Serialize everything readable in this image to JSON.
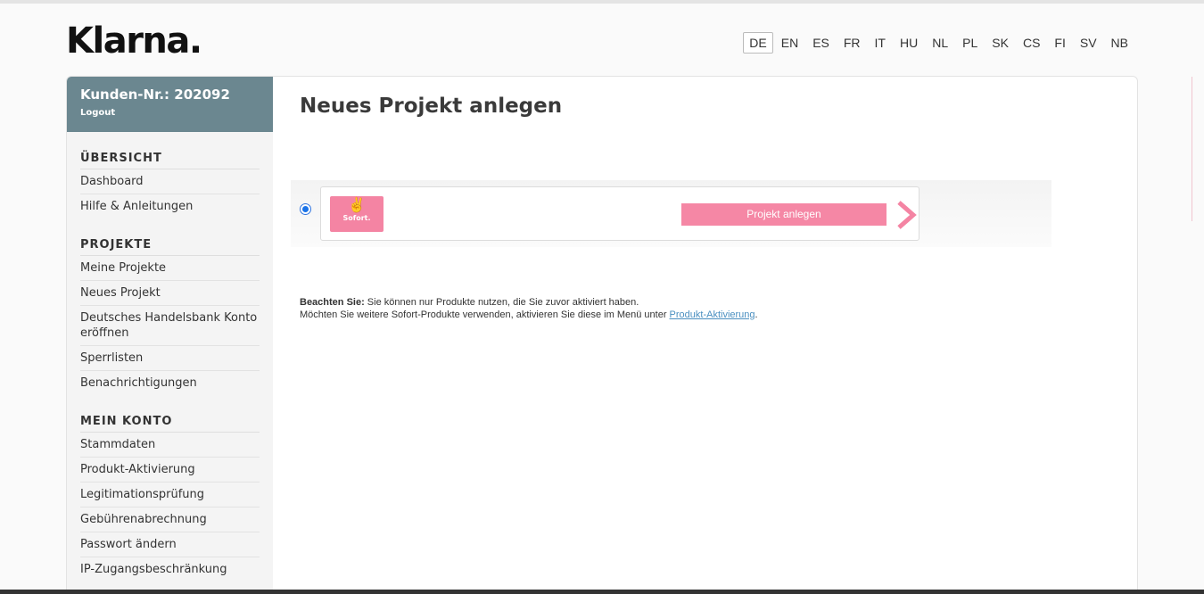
{
  "brand": {
    "logo_text": "Klarna."
  },
  "languages": {
    "active": "DE",
    "items": [
      "DE",
      "EN",
      "ES",
      "FR",
      "IT",
      "HU",
      "NL",
      "PL",
      "SK",
      "CS",
      "FI",
      "SV",
      "NB"
    ]
  },
  "account": {
    "customer_number": "Kunden-Nr.: 202092",
    "logout": "Logout"
  },
  "sidebar": {
    "sections": [
      {
        "title": "ÜBERSICHT",
        "items": [
          "Dashboard",
          "Hilfe & Anleitungen"
        ]
      },
      {
        "title": "PROJEKTE",
        "items": [
          "Meine Projekte",
          "Neues Projekt",
          "Deutsches Handelsbank Konto eröffnen",
          "Sperrlisten",
          "Benachrichtigungen"
        ]
      },
      {
        "title": "MEIN KONTO",
        "items": [
          "Stammdaten",
          "Produkt-Aktivierung",
          "Legitimationsprüfung",
          "Gebührenabrechnung",
          "Passwort ändern",
          "IP-Zugangsbeschränkung"
        ]
      }
    ]
  },
  "main": {
    "title": "Neues Projekt anlegen",
    "product": {
      "logo_text": "Sofort.",
      "button_label": "Projekt anlegen",
      "selected": true
    },
    "note": {
      "bold": "Beachten Sie:",
      "line1": " Sie können nur Produkte nutzen, die Sie zuvor aktiviert haben.",
      "line2": "Möchten Sie weitere Sofort-Produkte verwenden, aktivieren Sie diese im Menü unter ",
      "link": "Produkt-Aktivierung",
      "end": "."
    }
  },
  "colors": {
    "sidebar_header": "#6b8790",
    "sofort_pink": "#f484a3",
    "link": "#4a8fc0"
  }
}
